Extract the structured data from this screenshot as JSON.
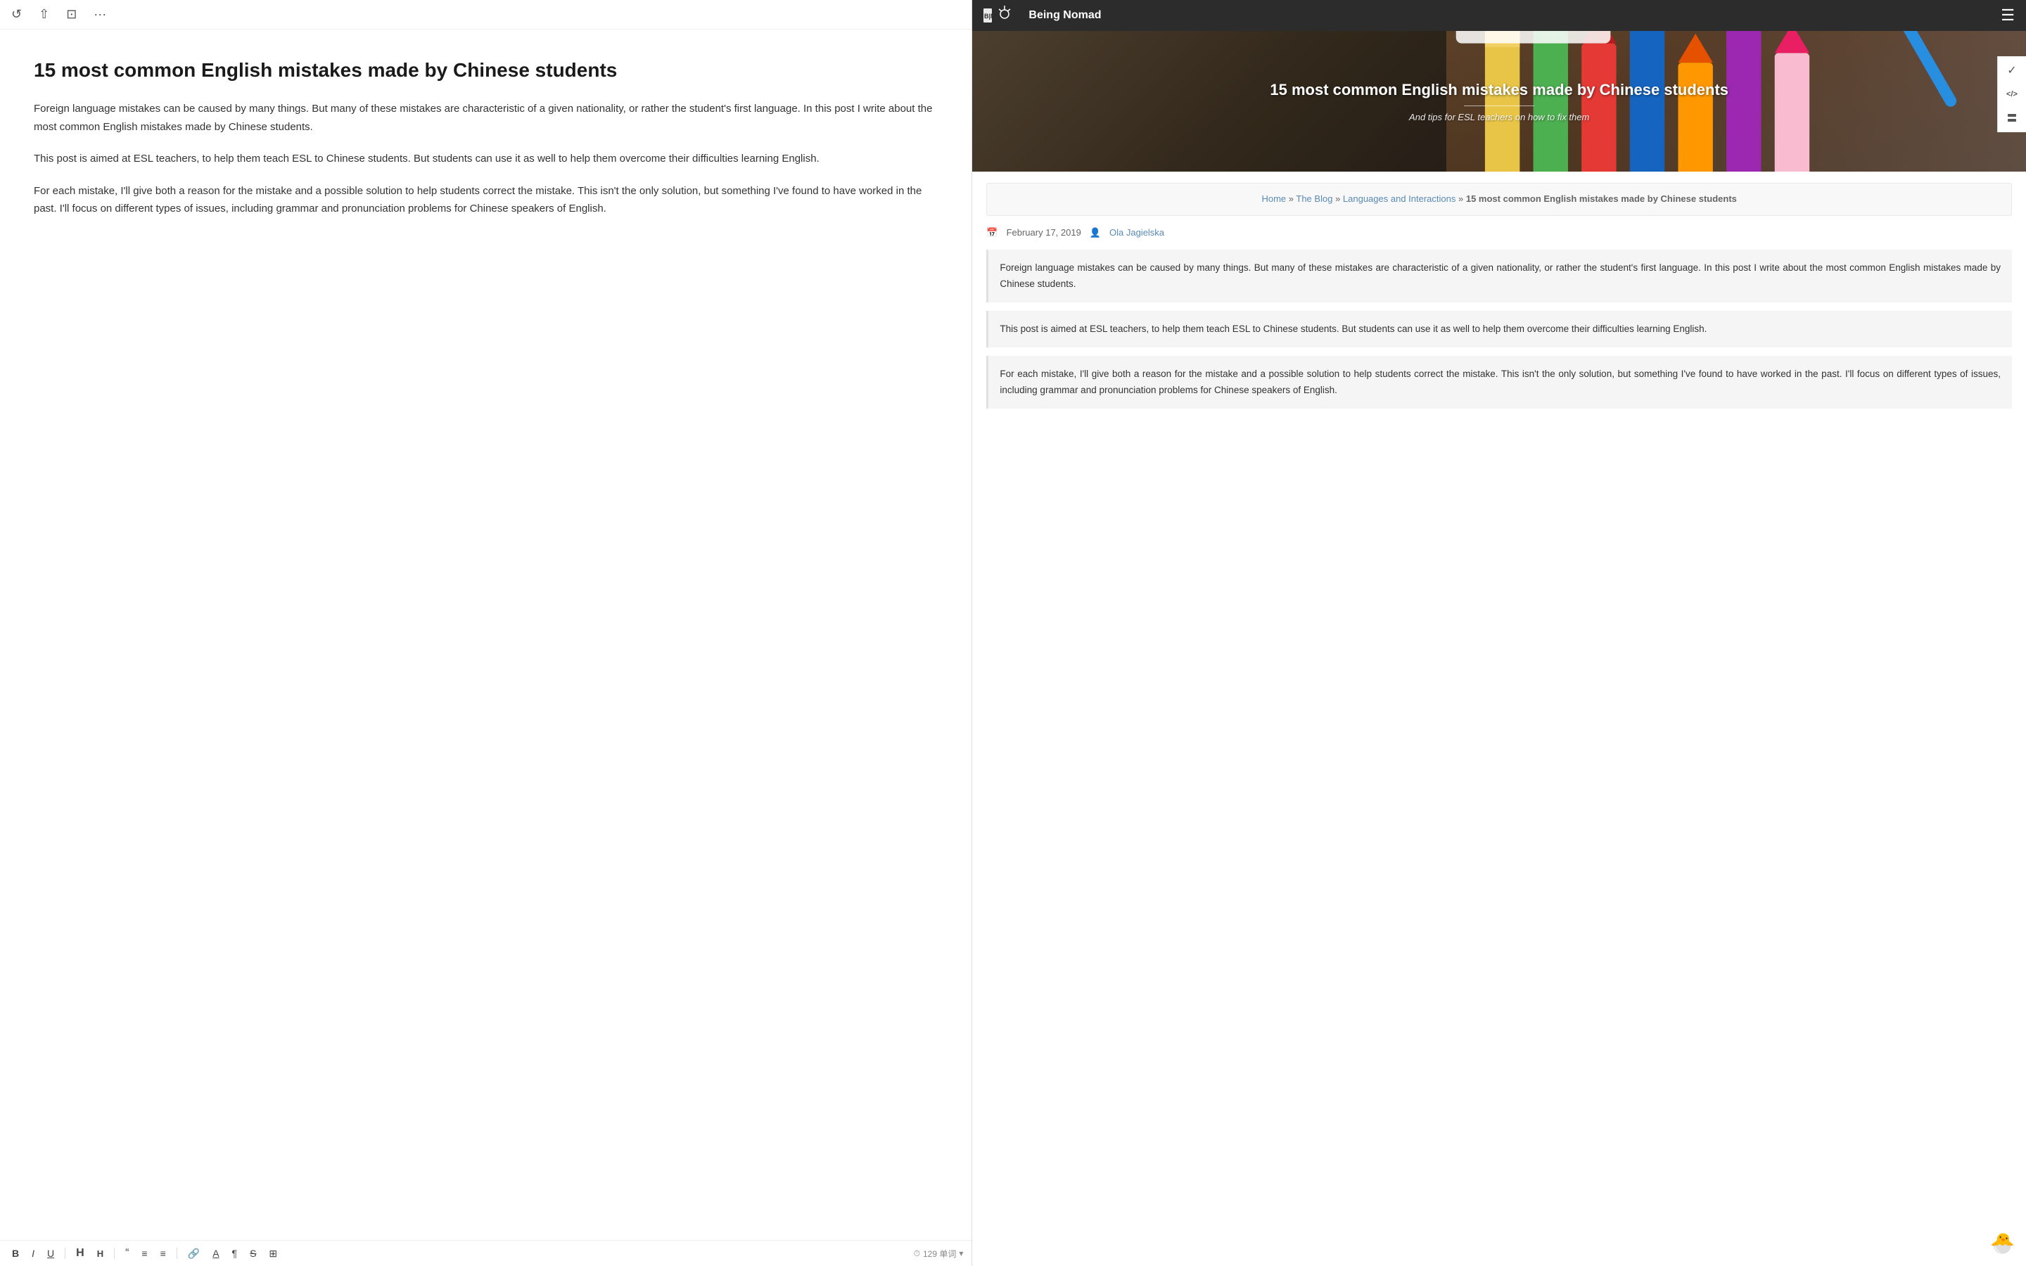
{
  "leftPanel": {
    "title": "15 most common English mistakes made by Chinese students",
    "paragraphs": [
      "Foreign language mistakes can be caused by many things. But many of these mistakes are characteristic of a given nationality, or rather the student's first language. In this post I write about the most common English mistakes made by Chinese students.",
      "This post is aimed at ESL teachers, to help them teach ESL to Chinese students. But students can use it as well to help them overcome their difficulties learning English.",
      "For each mistake, I'll give both a reason for the mistake and a possible solution to help students correct the mistake. This isn't the only solution, but something I've found to have worked in the past. I'll focus on different types of issues, including grammar and pronunciation problems for Chinese speakers of English."
    ],
    "wordCount": "129 单词",
    "toolbar": {
      "bold": "B",
      "italic": "I",
      "underline": "U",
      "heading1": "H",
      "heading2": "H",
      "quoteOpen": "“",
      "listBullet": "≡",
      "listNumber": "≡",
      "link": "🔗",
      "underlineA": "A",
      "para": "¶",
      "strikethrough": "S",
      "image": "⊞"
    }
  },
  "rightPanel": {
    "nav": {
      "logoText": "Being Nomad",
      "logoIcon": "🏕"
    },
    "hero": {
      "title": "15 most common English mistakes made by Chinese students",
      "subtitle": "And tips for ESL teachers on how to fix them"
    },
    "breadcrumb": {
      "home": "Home",
      "blog": "The Blog",
      "category": "Languages and Interactions",
      "current": "15 most common English mistakes made by Chinese students",
      "sep": "»"
    },
    "meta": {
      "date": "February 17, 2019",
      "author": "Ola Jagielska",
      "calIcon": "📅",
      "personIcon": "👤"
    },
    "paragraphs": [
      "Foreign language mistakes can be caused by many things. But many of these mistakes are characteristic of a given nationality, or rather the student's first language. In this post I write about the most common English mistakes made by Chinese students.",
      "This post is aimed at ESL teachers, to help them teach ESL to Chinese students. But students can use it as well to help them overcome their difficulties learning English.",
      "For each mistake, I'll give both a reason for the mistake and a possible solution to help students correct the mistake. This isn't the only solution, but something I've found to have worked in the past. I'll focus on different types of issues, including grammar and pronunciation problems for Chinese speakers of English."
    ]
  },
  "topToolbar": {
    "refresh": "↺",
    "share": "⇧",
    "expand": "⊡",
    "more": "···"
  },
  "sidebarIcons": {
    "check": "✓",
    "code": "</>",
    "stack": "⊟"
  },
  "emoji": "🐣"
}
